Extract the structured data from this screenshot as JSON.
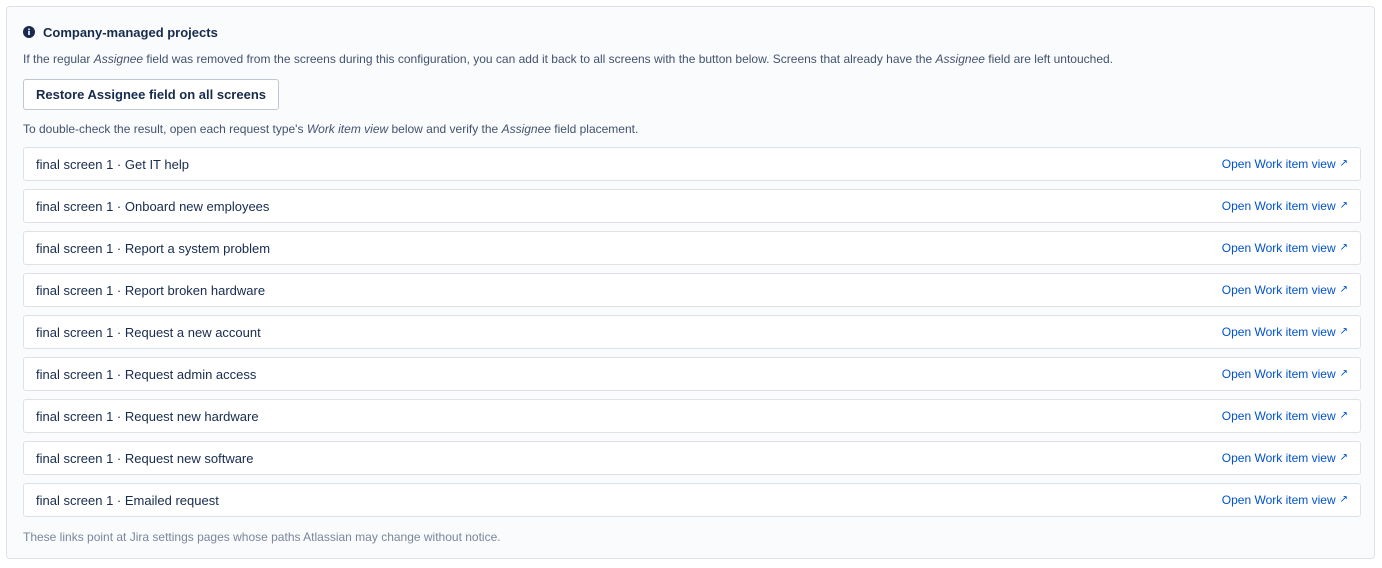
{
  "section": {
    "title": "Company-managed projects",
    "info_icon": "info-icon",
    "description": {
      "part1": "If the regular ",
      "em1": "Assignee",
      "part2": " field was removed from the screens during this configuration, you can add it back to all screens with the button below. Screens that already have the ",
      "em2": "Assignee",
      "part3": " field are left untouched."
    },
    "restore_button_label": "Restore Assignee field on all screens",
    "hint": {
      "part1": "To double-check the result, open each request type's ",
      "em1": "Work item view",
      "part2": " below and verify the ",
      "em2": "Assignee",
      "part3": " field placement."
    },
    "link_label": "Open Work item view",
    "link_icon": "external-link-icon",
    "rows": [
      {
        "label": "final screen 1 · Get IT help"
      },
      {
        "label": "final screen 1 · Onboard new employees"
      },
      {
        "label": "final screen 1 · Report a system problem"
      },
      {
        "label": "final screen 1 · Report broken hardware"
      },
      {
        "label": "final screen 1 · Request a new account"
      },
      {
        "label": "final screen 1 · Request admin access"
      },
      {
        "label": "final screen 1 · Request new hardware"
      },
      {
        "label": "final screen 1 · Request new software"
      },
      {
        "label": "final screen 1 · Emailed request"
      }
    ],
    "footer": "These links point at Jira settings pages whose paths Atlassian may change without notice."
  },
  "colors": {
    "link": "#0052cc",
    "text": "#172b4d",
    "muted": "#7a869a"
  }
}
